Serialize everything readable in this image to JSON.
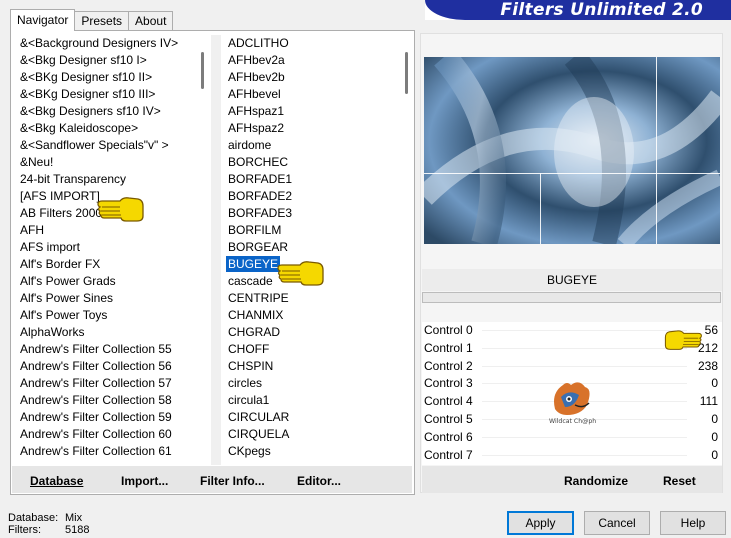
{
  "banner": {
    "title": "Filters Unlimited 2.0"
  },
  "tabs": [
    {
      "label": "Navigator",
      "active": true
    },
    {
      "label": "Presets",
      "active": false
    },
    {
      "label": "About",
      "active": false
    }
  ],
  "categories": [
    "&<Background Designers IV>",
    "&<Bkg Designer sf10 I>",
    "&<BKg Designer sf10 II>",
    "&<BKg Designer sf10 III>",
    "&<Bkg Designers sf10 IV>",
    "&<Bkg Kaleidoscope>",
    "&<Sandflower Specials\"v\" >",
    "&Neu!",
    "24-bit Transparency",
    "[AFS IMPORT]",
    "AB Filters 2000",
    "AFH",
    "AFS import",
    "Alf's Border FX",
    "Alf's Power Grads",
    "Alf's Power Sines",
    "Alf's Power Toys",
    "AlphaWorks",
    "Andrew's Filter Collection 55",
    "Andrew's Filter Collection 56",
    "Andrew's Filter Collection 57",
    "Andrew's Filter Collection 58",
    "Andrew's Filter Collection 59",
    "Andrew's Filter Collection 60",
    "Andrew's Filter Collection 61"
  ],
  "filters": {
    "items": [
      "ADCLITHO",
      "AFHbev2a",
      "AFHbev2b",
      "AFHbevel",
      "AFHspaz1",
      "AFHspaz2",
      "airdome",
      "BORCHEC",
      "BORFADE1",
      "BORFADE2",
      "BORFADE3",
      "BORFILM",
      "BORGEAR",
      "BUGEYE",
      "cascade",
      "CENTRIPE",
      "CHANMIX",
      "CHGRAD",
      "CHOFF",
      "CHSPIN",
      "circles",
      "circula1",
      "CIRCULAR",
      "CIRQUELA",
      "CKpegs"
    ],
    "selected": "BUGEYE"
  },
  "left_buttons": {
    "database": "Database",
    "import": "Import...",
    "filter_info": "Filter Info...",
    "editor": "Editor..."
  },
  "preview": {
    "filter_name": "BUGEYE"
  },
  "controls": [
    {
      "label": "Control 0",
      "value": "56"
    },
    {
      "label": "Control 1",
      "value": "212"
    },
    {
      "label": "Control 2",
      "value": "238"
    },
    {
      "label": "Control 3",
      "value": "0"
    },
    {
      "label": "Control 4",
      "value": "111"
    },
    {
      "label": "Control 5",
      "value": "0"
    },
    {
      "label": "Control 6",
      "value": "0"
    },
    {
      "label": "Control 7",
      "value": "0"
    }
  ],
  "right_buttons": {
    "randomize": "Randomize",
    "reset": "Reset"
  },
  "status": {
    "database_label": "Database:",
    "database_value": "Mix",
    "filters_label": "Filters:",
    "filters_value": "5188"
  },
  "dialog_buttons": {
    "apply": "Apply",
    "cancel": "Cancel",
    "help": "Help"
  },
  "watermark": {
    "text": "Wildcat Ch@ph"
  },
  "colors": {
    "banner": "#1f2fa0",
    "selection": "#0a64c8",
    "apply_border": "#0078d7",
    "hand": "#f5d800"
  },
  "icons": {
    "pointer": "pointing-hand-icon"
  }
}
